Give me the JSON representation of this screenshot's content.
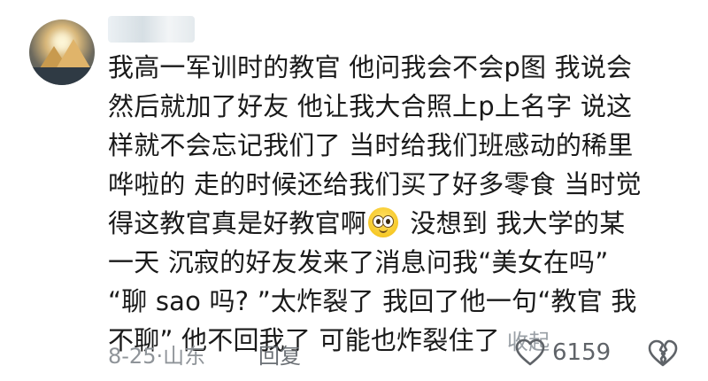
{
  "comment": {
    "lines": [
      "我高一军训时的教官 他问我会不会p图 我说会",
      "然后就加了好友 他让我大合照上p上名字 说这",
      "样就不会忘记我们了 当时给我们班感动的稀里",
      "哗啦的 走的时候还给我们买了好多零食 当时觉",
      "得这教官真是好教官啊",
      " 没想到 我大学的某",
      "一天 沉寂的好友发来了消息问我“美女在吗”",
      "“聊 sao 吗? ”太炸裂了 我回了他一句“教官 我",
      "不聊” 他不回我了 可能也炸裂住了"
    ],
    "emoji_name": "pleading-face-emoji",
    "collapse_label": "收起"
  },
  "meta": {
    "date_location": "8-25·山东",
    "reply_label": "回复",
    "like_count": "6159"
  },
  "colors": {
    "text": "#1a1a1a",
    "muted": "#8f9499",
    "icon": "#5f6368"
  }
}
